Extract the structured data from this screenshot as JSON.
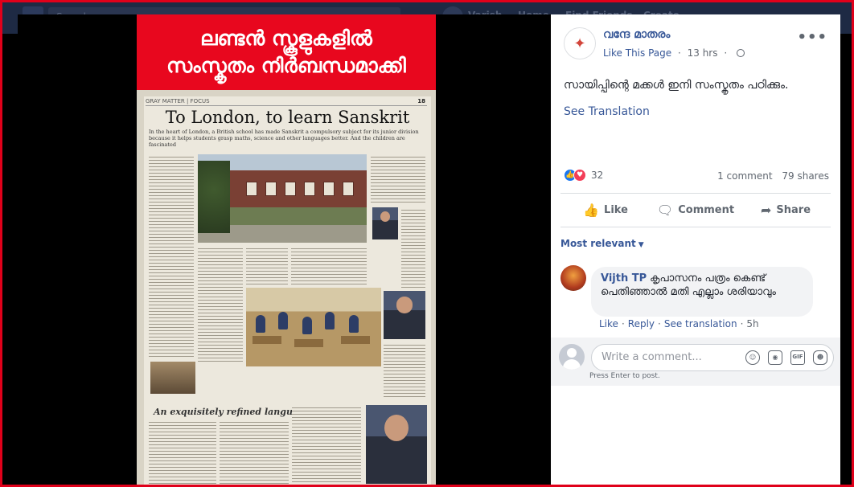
{
  "topbar": {
    "search_placeholder": "Search",
    "nav_items": [
      "Varish",
      "Home",
      "Find Friends",
      "Create"
    ]
  },
  "photo": {
    "banner_line1": "ലണ്ടൻ സ്കൂളുകളിൽ",
    "banner_line2": "സംസ്കൃതം നിർബന്ധമാക്കി",
    "paper_section": "GRAY MATTER | FOCUS",
    "paper_page": "18",
    "paper_title": "To London, to learn Sanskrit",
    "paper_lede": "In the heart of London, a British school has made Sanskrit a compulsory subject for its junior division because it helps students grasp maths, science and other languages better. And the children are fascinated",
    "paper_subtitle": "An exquisitely refined language"
  },
  "post": {
    "page_name": "വന്ദേ മാതരം",
    "like_page": "Like This Page",
    "time": "13 hrs",
    "text": "സായിപ്പിന്റെ മക്കൾ ഇനി സംസ്കൃതം പഠിക്കും.",
    "see_translation": "See Translation",
    "reaction_count": "32",
    "comments_count": "1 comment",
    "shares_count": "79 shares",
    "actions": {
      "like": "Like",
      "comment": "Comment",
      "share": "Share"
    },
    "sort_label": "Most relevant",
    "comment": {
      "author": "Vijth TP",
      "text": "കൃപാസനം പത്രം കെണ്ട് പെതിഞ്ഞാൽ മതി എല്ലാം ശരിയാവും",
      "like": "Like",
      "reply": "Reply",
      "see_translation": "See translation",
      "time": "5h"
    },
    "composer_placeholder": "Write a comment...",
    "press_enter": "Press Enter to post."
  },
  "colors": {
    "fb_blue": "#385898",
    "banner_red": "#e8071e",
    "frame_red": "#e0001a"
  }
}
